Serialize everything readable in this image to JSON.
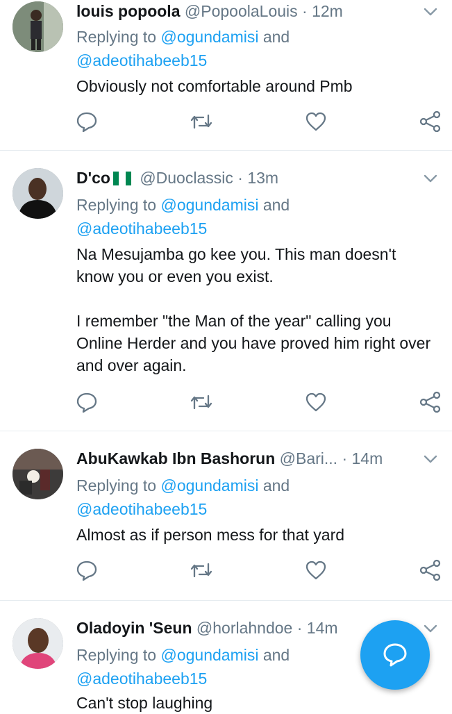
{
  "tweets": [
    {
      "name": "louis popoola",
      "handle": "@PopoolaLouis",
      "dot": "·",
      "time": "12m",
      "replying_prefix": "Replying to ",
      "mention1": "@ogundamisi",
      "replying_and": " and",
      "mention2": "@adeotihabeeb15",
      "text": "Obviously not comfortable around Pmb"
    },
    {
      "name": "D'co",
      "handle": "@Duoclassic",
      "dot": "·",
      "time": "13m",
      "replying_prefix": "Replying to ",
      "mention1": "@ogundamisi",
      "replying_and": " and",
      "mention2": "@adeotihabeeb15",
      "text": "Na Mesujamba go kee you. This man doesn't know you or even you exist.\n\nI remember \"the Man of the year\" calling you Online Herder and you have proved him right over and over again."
    },
    {
      "name": "AbuKawkab Ibn Bashorun",
      "handle": "@Bari...",
      "dot": "·",
      "time": "14m",
      "replying_prefix": "Replying to ",
      "mention1": "@ogundamisi",
      "replying_and": " and",
      "mention2": "@adeotihabeeb15",
      "text": "Almost as if person mess for that yard"
    },
    {
      "name": "Oladoyin 'Seun",
      "handle": "@horlahndoe",
      "dot": "·",
      "time": "14m",
      "replying_prefix": "Replying to ",
      "mention1": "@ogundamisi",
      "replying_and": " and",
      "mention2": "@adeotihabeeb15",
      "text": "Can't stop laughing"
    }
  ],
  "icons": {
    "reply": "reply-icon",
    "retweet": "retweet-icon",
    "like": "heart-icon",
    "share": "share-icon",
    "caret": "chevron-down-icon",
    "flag": "nigeria-flag-icon",
    "compose": "compose-reply-icon"
  },
  "colors": {
    "accent": "#1da1f2",
    "secondary_text": "#657786",
    "divider": "#e6ecf0",
    "flag_green": "#008751"
  }
}
